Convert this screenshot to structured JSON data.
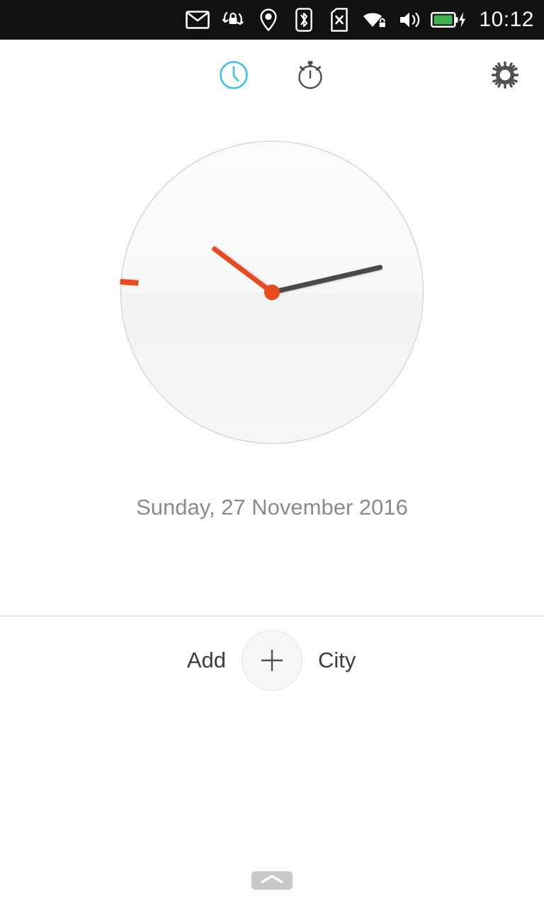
{
  "statusbar": {
    "time": "10:12",
    "background": "#111111",
    "icons": [
      {
        "name": "mail-icon",
        "label": "Messages"
      },
      {
        "name": "rotation-lock-icon",
        "label": "Rotation lock"
      },
      {
        "name": "location-icon",
        "label": "Location"
      },
      {
        "name": "bluetooth-icon",
        "label": "Bluetooth"
      },
      {
        "name": "sim-card-missing-icon",
        "label": "No SIM"
      },
      {
        "name": "wifi-secure-icon",
        "label": "Wi-Fi secured"
      },
      {
        "name": "volume-icon",
        "label": "Sound"
      },
      {
        "name": "battery-charging-icon",
        "label": "Battery charging"
      }
    ],
    "battery_color": "#3eb34f"
  },
  "tabs": {
    "active": "clock",
    "items": [
      {
        "id": "clock",
        "name": "tab-clock",
        "label": "Clock",
        "icon": "clock-icon",
        "active": true
      },
      {
        "id": "stopwatch",
        "name": "tab-stopwatch",
        "label": "Stopwatch",
        "icon": "stopwatch-icon",
        "active": false
      }
    ],
    "settings": {
      "name": "settings-button",
      "label": "Settings",
      "icon": "gear-icon"
    },
    "active_color": "#3fc0f0",
    "inactive_color": "#4f4f4f"
  },
  "clock": {
    "name": "analog-clock",
    "hour_angle": -13,
    "minute_angle": -143,
    "second_angle": 184,
    "hour_hand_color": "#4a4a4a",
    "minute_hand_color": "#e8491d",
    "second_hand_color": "#e8491d",
    "hub_color": "#e8491d",
    "displayed_time": "10:12"
  },
  "date": {
    "text": "Sunday, 27 November 2016"
  },
  "add_city": {
    "prefix_label": "Add",
    "suffix_label": "City",
    "button_name": "add-city-button",
    "button_icon": "plus-icon"
  },
  "bottom_handle": {
    "name": "bottom-edge-handle",
    "icon": "chevron-up-icon"
  }
}
